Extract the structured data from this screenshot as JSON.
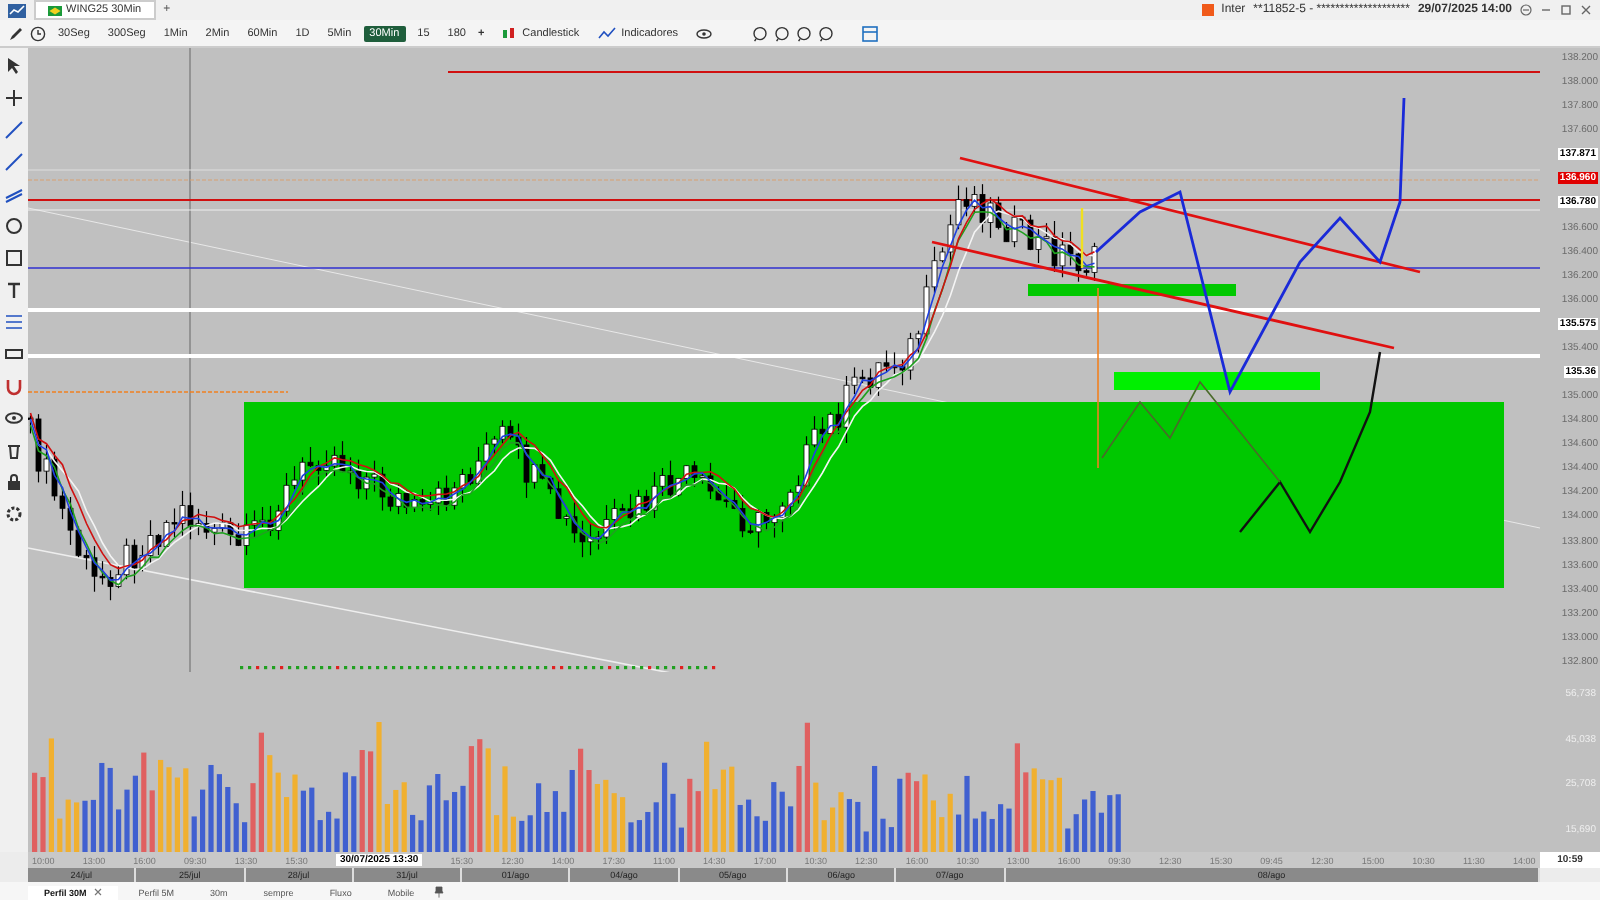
{
  "window": {
    "tab_title": "WING25 30Min",
    "new_tab": "+",
    "broker": "Inter",
    "account": "**11852-5 - ********************",
    "datetime": "29/07/2025 14:00"
  },
  "toolbar": {
    "timeframes": [
      {
        "label": "30Seg",
        "selected": false
      },
      {
        "label": "300Seg",
        "selected": false
      },
      {
        "label": "1Min",
        "selected": false
      },
      {
        "label": "2Min",
        "selected": false
      },
      {
        "label": "60Min",
        "selected": false
      },
      {
        "label": "1D",
        "selected": false
      },
      {
        "label": "5Min",
        "selected": false
      },
      {
        "label": "30Min",
        "selected": true
      },
      {
        "label": "15",
        "selected": false
      },
      {
        "label": "180",
        "selected": false
      }
    ],
    "add": "+",
    "chart_type": "Candlestick",
    "indicators": "Indicadores"
  },
  "price_axis": {
    "labels": [
      {
        "text": "138.200",
        "kind": "tick"
      },
      {
        "text": "138.000",
        "kind": "tick"
      },
      {
        "text": "137.800",
        "kind": "tick"
      },
      {
        "text": "137.600",
        "kind": "tick"
      },
      {
        "text": "137.871",
        "kind": "marker"
      },
      {
        "text": "136.960",
        "kind": "highlight"
      },
      {
        "text": "136.780",
        "kind": "marker"
      },
      {
        "text": "136.600",
        "kind": "tick"
      },
      {
        "text": "136.400",
        "kind": "tick"
      },
      {
        "text": "136.200",
        "kind": "tick"
      },
      {
        "text": "136.000",
        "kind": "tick"
      },
      {
        "text": "135.575",
        "kind": "marker"
      },
      {
        "text": "135.400",
        "kind": "tick"
      },
      {
        "text": "135.36",
        "kind": "marker"
      },
      {
        "text": "135.000",
        "kind": "tick"
      },
      {
        "text": "134.800",
        "kind": "tick"
      },
      {
        "text": "134.600",
        "kind": "tick"
      },
      {
        "text": "134.400",
        "kind": "tick"
      },
      {
        "text": "134.200",
        "kind": "tick"
      },
      {
        "text": "134.000",
        "kind": "tick"
      },
      {
        "text": "133.800",
        "kind": "tick"
      },
      {
        "text": "133.600",
        "kind": "tick"
      },
      {
        "text": "133.400",
        "kind": "tick"
      },
      {
        "text": "133.200",
        "kind": "tick"
      },
      {
        "text": "133.000",
        "kind": "tick"
      },
      {
        "text": "132.800",
        "kind": "tick"
      }
    ]
  },
  "volume_axis": {
    "ticks": [
      "56,738",
      "45,038",
      "25,708",
      "15,690"
    ]
  },
  "time_axis": {
    "labels": [
      {
        "text": "10:00",
        "kind": "time"
      },
      {
        "text": "13:00",
        "kind": "time"
      },
      {
        "text": "16:00",
        "kind": "time"
      },
      {
        "text": "09:30",
        "kind": "time"
      },
      {
        "text": "13:30",
        "kind": "time"
      },
      {
        "text": "15:30",
        "kind": "time"
      },
      {
        "text": "30/07/2025 13:30",
        "kind": "cursor"
      },
      {
        "text": "15:30",
        "kind": "time"
      },
      {
        "text": "12:30",
        "kind": "time"
      },
      {
        "text": "14:00",
        "kind": "time"
      },
      {
        "text": "17:30",
        "kind": "time"
      },
      {
        "text": "11:00",
        "kind": "time"
      },
      {
        "text": "14:30",
        "kind": "time"
      },
      {
        "text": "17:00",
        "kind": "time"
      },
      {
        "text": "10:30",
        "kind": "time"
      },
      {
        "text": "12:30",
        "kind": "time"
      },
      {
        "text": "16:00",
        "kind": "time"
      },
      {
        "text": "10:30",
        "kind": "time"
      },
      {
        "text": "13:00",
        "kind": "time"
      },
      {
        "text": "16:00",
        "kind": "time"
      },
      {
        "text": "09:30",
        "kind": "time"
      },
      {
        "text": "12:30",
        "kind": "time"
      },
      {
        "text": "15:30",
        "kind": "time"
      },
      {
        "text": "09:45",
        "kind": "time"
      },
      {
        "text": "12:30",
        "kind": "time"
      },
      {
        "text": "15:00",
        "kind": "time"
      },
      {
        "text": "10:30",
        "kind": "time"
      },
      {
        "text": "11:30",
        "kind": "time"
      },
      {
        "text": "14:00",
        "kind": "time"
      }
    ],
    "dates": [
      "24/jul",
      "25/jul",
      "28/jul",
      "31/jul",
      "01/ago",
      "04/ago",
      "05/ago",
      "06/ago",
      "07/ago",
      "08/ago"
    ]
  },
  "clock": "10:59",
  "bottom_tabs": [
    {
      "label": "Perfil 30M",
      "selected": true,
      "closable": true
    },
    {
      "label": "Perfil 5M",
      "selected": false,
      "closable": false
    },
    {
      "label": "30m",
      "selected": false,
      "closable": false
    },
    {
      "label": "sempre",
      "selected": false,
      "closable": false
    },
    {
      "label": "Fluxo",
      "selected": false,
      "closable": false
    },
    {
      "label": "Mobile",
      "selected": false,
      "closable": false
    }
  ]
}
